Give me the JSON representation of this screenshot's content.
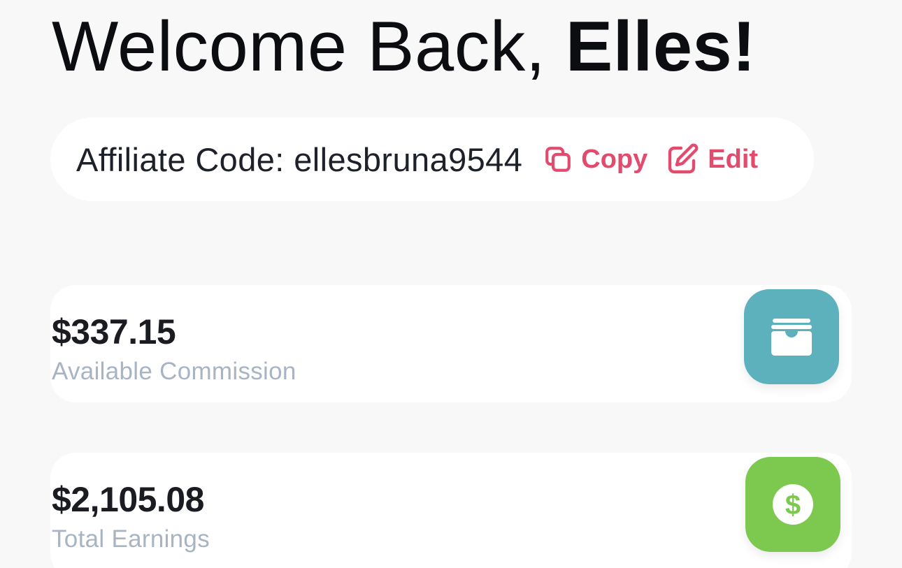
{
  "header": {
    "greeting": "Welcome Back,",
    "name": "Elles!"
  },
  "affiliate": {
    "label": "Affiliate Code:",
    "code": "ellesbruna9544",
    "copy_label": "Copy",
    "edit_label": "Edit",
    "accent_color": "#e24b6e"
  },
  "stats": [
    {
      "value": "$337.15",
      "label": "Available Commission",
      "icon": "wallet-icon",
      "color": "#5cb1bd"
    },
    {
      "value": "$2,105.08",
      "label": "Total Earnings",
      "icon": "dollar-icon",
      "color": "#7dc84f"
    }
  ]
}
